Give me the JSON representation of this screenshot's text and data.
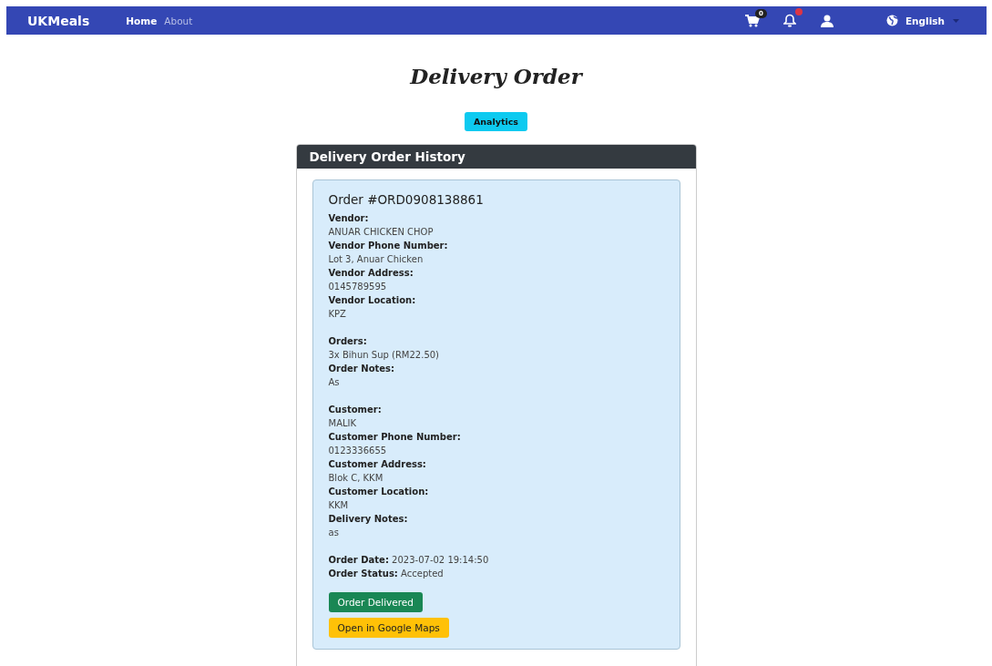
{
  "navbar": {
    "brand": "UKMeals",
    "links": [
      {
        "label": "Home",
        "selected": true
      },
      {
        "label": "About",
        "selected": false
      }
    ],
    "cart_count": "0",
    "notifications_unread": true,
    "language": "English"
  },
  "page_title": "Delivery Order",
  "analytics_button": "Analytics",
  "history": {
    "title": "Delivery Order History",
    "order": {
      "title": "Order #ORD0908138861",
      "groups": [
        {
          "fields": [
            {
              "kind": "stacked",
              "label": "Vendor:",
              "value": "ANUAR CHICKEN CHOP"
            },
            {
              "kind": "stacked",
              "label": "Vendor Phone Number:",
              "value": "Lot 3, Anuar Chicken"
            },
            {
              "kind": "stacked",
              "label": "Vendor Address:",
              "value": "0145789595"
            },
            {
              "kind": "stacked",
              "label": "Vendor Location:",
              "value": "KPZ"
            }
          ]
        },
        {
          "fields": [
            {
              "kind": "stacked",
              "label": "Orders:",
              "value": "3x Bihun Sup (RM22.50)"
            },
            {
              "kind": "stacked",
              "label": "Order Notes:",
              "value": "As"
            }
          ]
        },
        {
          "fields": [
            {
              "kind": "stacked",
              "label": "Customer:",
              "value": "MALIK"
            },
            {
              "kind": "stacked",
              "label": "Customer Phone Number:",
              "value": "0123336655"
            },
            {
              "kind": "stacked",
              "label": "Customer Address:",
              "value": "Blok C, KKM"
            },
            {
              "kind": "stacked",
              "label": "Customer Location:",
              "value": "KKM"
            },
            {
              "kind": "stacked",
              "label": "Delivery Notes:",
              "value": "as"
            }
          ]
        },
        {
          "fields": [
            {
              "kind": "inline",
              "label": "Order Date:",
              "value": "2023-07-02 19:14:50"
            },
            {
              "kind": "inline",
              "label": "Order Status:",
              "value": "Accepted"
            }
          ]
        }
      ],
      "buttons": [
        {
          "kind": "success",
          "label": "Order Delivered"
        },
        {
          "kind": "warning",
          "label": "Open in Google Maps"
        }
      ]
    }
  }
}
